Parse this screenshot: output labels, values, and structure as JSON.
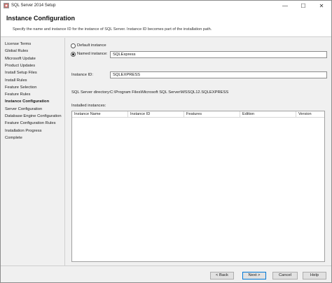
{
  "window": {
    "title": "SQL Server 2014 Setup",
    "minimize": "—",
    "maximize": "☐",
    "close": "✕"
  },
  "header": {
    "title": "Instance Configuration",
    "description": "Specify the name and instance ID for the instance of SQL Server. Instance ID becomes part of the installation path."
  },
  "sidebar": {
    "items": [
      {
        "label": "License Terms"
      },
      {
        "label": "Global Rules"
      },
      {
        "label": "Microsoft Update"
      },
      {
        "label": "Product Updates"
      },
      {
        "label": "Install Setup Files"
      },
      {
        "label": "Install Rules"
      },
      {
        "label": "Feature Selection"
      },
      {
        "label": "Feature Rules"
      },
      {
        "label": "Instance Configuration",
        "active": true
      },
      {
        "label": "Server Configuration"
      },
      {
        "label": "Database Engine Configuration"
      },
      {
        "label": "Feature Configuration Rules"
      },
      {
        "label": "Installation Progress"
      },
      {
        "label": "Complete"
      }
    ]
  },
  "form": {
    "default_instance_label": "Default instance",
    "named_instance_label": "Named instance:",
    "named_instance_value": "SQLExpress",
    "instance_id_label": "Instance ID:",
    "instance_id_value": "SQLEXPRESS",
    "directory_label": "SQL Server directory:",
    "directory_value": "C:\\Program Files\\Microsoft SQL Server\\MSSQL12.SQLEXPRESS",
    "installed_label": "Installed instances:"
  },
  "table": {
    "columns": [
      "Instance Name",
      "Instance ID",
      "Features",
      "Edition",
      "Version"
    ]
  },
  "footer": {
    "back": "< Back",
    "next": "Next >",
    "cancel": "Cancel",
    "help": "Help"
  },
  "colors": {
    "accent": "#0078d7",
    "background": "#f0f0f0"
  }
}
